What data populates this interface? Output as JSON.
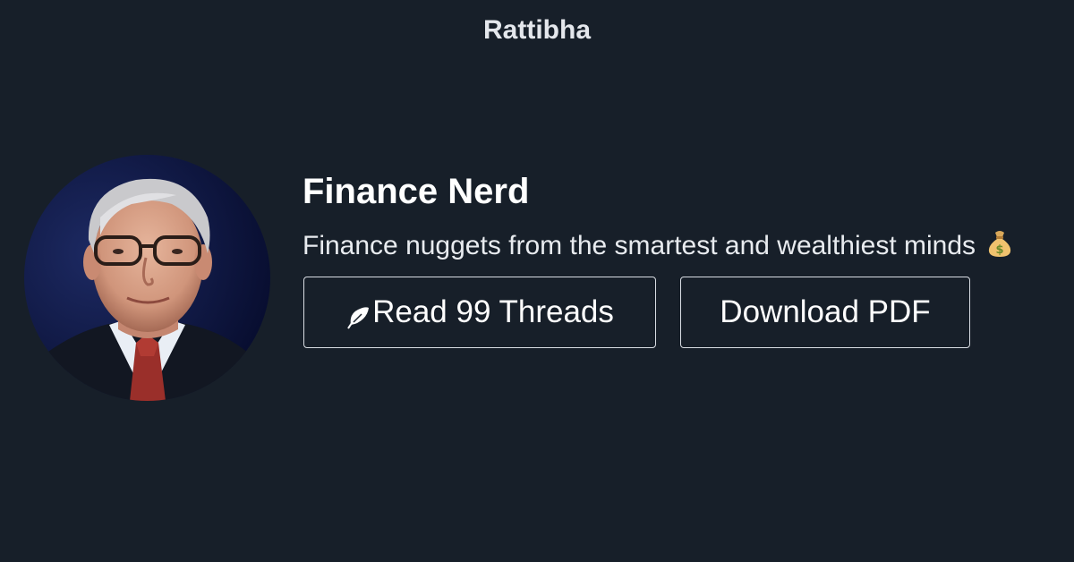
{
  "header": {
    "brand": "Rattibha"
  },
  "profile": {
    "name": "Finance Nerd",
    "bio": "Finance nuggets from the smartest and wealthiest minds",
    "bio_emoji_icon": "money-bag-icon",
    "avatar_icon": "profile-photo"
  },
  "actions": {
    "read_threads_label": "Read 99 Threads",
    "read_threads_icon": "feather-icon",
    "download_pdf_label": "Download PDF"
  },
  "colors": {
    "background": "#171f29",
    "text": "#ffffff",
    "button_border": "#d9dde3"
  }
}
